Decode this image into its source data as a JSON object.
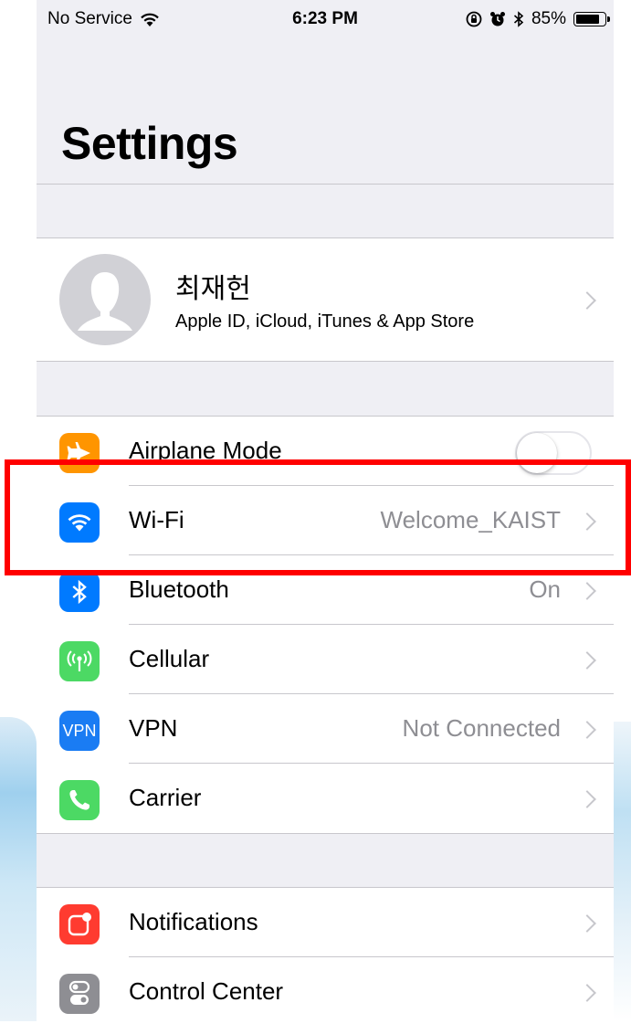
{
  "status_bar": {
    "carrier": "No Service",
    "time": "6:23 PM",
    "battery": "85%",
    "battery_level": 0.85,
    "icons": [
      "wifi-icon",
      "rotation-lock-icon",
      "alarm-icon",
      "bluetooth-icon",
      "battery-icon"
    ]
  },
  "header": {
    "title": "Settings"
  },
  "profile": {
    "name": "최재헌",
    "subtitle": "Apple ID, iCloud, iTunes & App Store"
  },
  "rows": [
    {
      "label": "Airplane Mode",
      "value": "",
      "icon": "airplane-icon",
      "color": "#ff9500",
      "toggle": false
    },
    {
      "label": "Wi-Fi",
      "value": "Welcome_KAIST",
      "icon": "wifi-icon",
      "color": "#007aff"
    },
    {
      "label": "Bluetooth",
      "value": "On",
      "icon": "bluetooth-icon",
      "color": "#007aff"
    },
    {
      "label": "Cellular",
      "value": "",
      "icon": "cellular-antenna-icon",
      "color": "#4cd964"
    },
    {
      "label": "VPN",
      "value": "Not Connected",
      "icon": "vpn-icon",
      "color": "#1a7cf3",
      "icon_text": "VPN"
    },
    {
      "label": "Carrier",
      "value": "",
      "icon": "phone-icon",
      "color": "#4cd964"
    }
  ],
  "rows2": [
    {
      "label": "Notifications",
      "value": "",
      "icon": "notifications-icon",
      "color": "#ff3b30"
    },
    {
      "label": "Control Center",
      "value": "",
      "icon": "control-center-icon",
      "color": "#8e8e93"
    }
  ],
  "annotation": {
    "highlight_color": "#ff0000",
    "target": "Wi-Fi"
  }
}
